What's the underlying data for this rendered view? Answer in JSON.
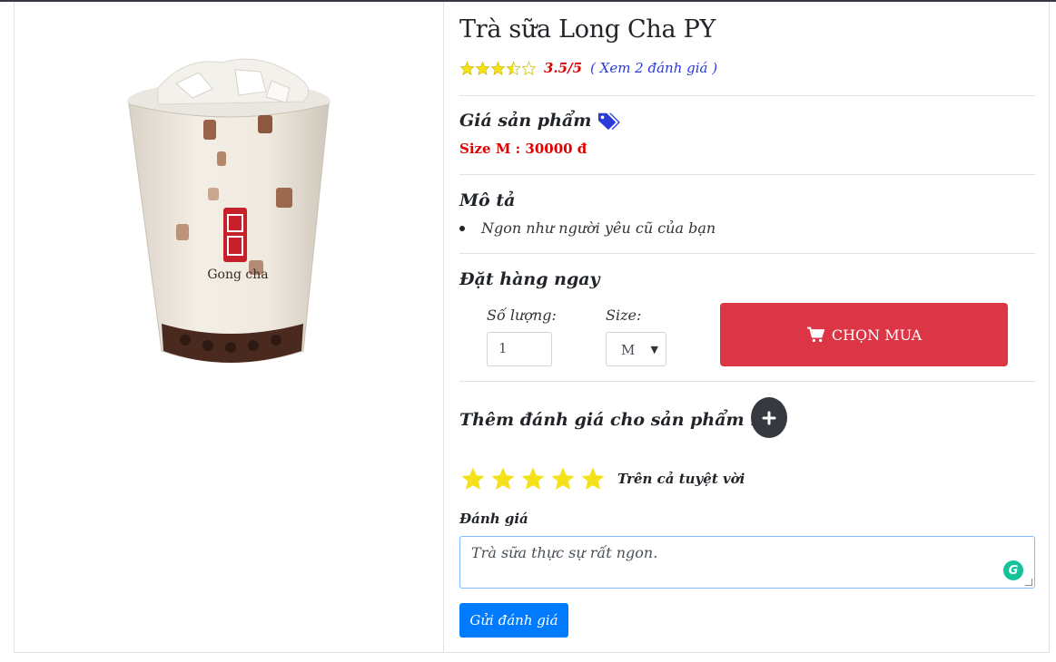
{
  "product": {
    "name": "Trà sữa Long Cha PY",
    "rating_value": "3.5/5",
    "rating_link": "( Xem 2 đánh giá )",
    "rating_stars": 3.5,
    "brand_text": "Gong cha"
  },
  "price_section": {
    "heading": "Giá sản phẩm",
    "price_text": "Size M : 30000 đ"
  },
  "description": {
    "heading": "Mô tả",
    "items": [
      "Ngon như người yêu cũ của bạn"
    ]
  },
  "order": {
    "heading": "Đặt hàng ngay",
    "qty_label": "Số lượng:",
    "qty_value": "1",
    "size_label": "Size:",
    "size_value": "M",
    "buy_label": "CHỌN MUA"
  },
  "review": {
    "heading": "Thêm đánh giá cho sản phẩm này",
    "stars_selected": 5,
    "star_caption": "Trên cả tuyệt vời",
    "field_label": "Đánh giá",
    "text_value": "Trà sữa thực sự rất ngon.",
    "submit_label": "Gửi đánh giá"
  },
  "colors": {
    "danger": "#dc3545",
    "primary": "#007bff",
    "star_yellow": "#f5e11a",
    "price_red": "#e00000",
    "link_blue": "#2a3bd8",
    "dark": "#343a40"
  }
}
